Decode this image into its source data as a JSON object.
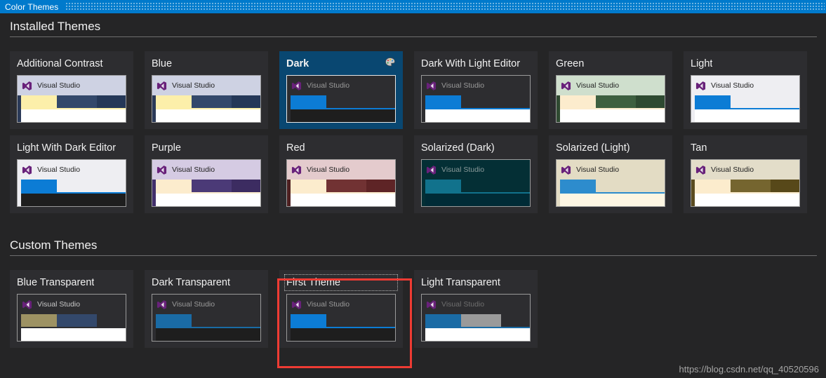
{
  "window": {
    "title": "Color Themes",
    "grip_icon": "dotted-grip-icon",
    "accent_color": "#007acc",
    "background_color": "#252526",
    "card_background_color": "#2d2d30",
    "selection_color": "#094771"
  },
  "sections": [
    {
      "id": "installed",
      "title": "Installed Themes"
    },
    {
      "id": "custom",
      "title": "Custom Themes"
    }
  ],
  "preview_logo_text": "Visual Studio",
  "installed_themes": [
    {
      "name": "Additional Contrast",
      "selected": false,
      "focused": false,
      "has_palette_icon": false,
      "colors": {
        "titlebar": "#ced2e3",
        "titlebar_text": "#1e1e1e",
        "gutter": "#2b3a58",
        "bar_a": "#fcefaa",
        "bar_b": "#33486b",
        "body": "#253858",
        "underline": "#fcefaa",
        "doc": "#ffffff"
      }
    },
    {
      "name": "Blue",
      "selected": false,
      "focused": false,
      "has_palette_icon": false,
      "colors": {
        "titlebar": "#ced2e3",
        "titlebar_text": "#1e1e1e",
        "gutter": "#2b3a58",
        "bar_a": "#fcefaa",
        "bar_b": "#33486b",
        "body": "#253858",
        "underline": "#fcefaa",
        "doc": "#ffffff"
      }
    },
    {
      "name": "Dark",
      "selected": true,
      "focused": false,
      "has_palette_icon": true,
      "palette_icon": "palette-icon",
      "colors": {
        "titlebar": "#2d2d30",
        "titlebar_text": "#9a9a9a",
        "gutter": "#2d2d30",
        "bar_a": "#0c7cd5",
        "bar_b": "#2d2d30",
        "body": "#2d2d30",
        "underline": "#0c7cd5",
        "doc": "#1e1e1e"
      }
    },
    {
      "name": "Dark With Light Editor",
      "selected": false,
      "focused": false,
      "has_palette_icon": false,
      "colors": {
        "titlebar": "#2d2d30",
        "titlebar_text": "#9a9a9a",
        "gutter": "#2d2d30",
        "bar_a": "#0c7cd5",
        "bar_b": "#2d2d30",
        "body": "#2d2d30",
        "underline": "#0c7cd5",
        "doc": "#ffffff"
      }
    },
    {
      "name": "Green",
      "selected": false,
      "focused": false,
      "has_palette_icon": false,
      "colors": {
        "titlebar": "#cfdfcd",
        "titlebar_text": "#1e1e1e",
        "gutter": "#2f4a31",
        "bar_a": "#fceccd",
        "bar_b": "#3e6040",
        "body": "#2e4a31",
        "underline": "#fceccd",
        "doc": "#ffffff"
      }
    },
    {
      "name": "Light",
      "selected": false,
      "focused": false,
      "has_palette_icon": false,
      "colors": {
        "titlebar": "#eeeef2",
        "titlebar_text": "#1e1e1e",
        "gutter": "#eeeef2",
        "bar_a": "#0c7cd5",
        "bar_b": "#eeeef2",
        "body": "#eeeef2",
        "underline": "#0c7cd5",
        "doc": "#ffffff"
      }
    },
    {
      "name": "Light With Dark Editor",
      "selected": false,
      "focused": false,
      "has_palette_icon": false,
      "colors": {
        "titlebar": "#eeeef2",
        "titlebar_text": "#1e1e1e",
        "gutter": "#eeeef2",
        "bar_a": "#0c7cd5",
        "bar_b": "#eeeef2",
        "body": "#eeeef2",
        "underline": "#0c7cd5",
        "doc": "#1e1e1e"
      }
    },
    {
      "name": "Purple",
      "selected": false,
      "focused": false,
      "has_palette_icon": false,
      "colors": {
        "titlebar": "#d5cbe3",
        "titlebar_text": "#1e1e1e",
        "gutter": "#422f6b",
        "bar_a": "#fceccd",
        "bar_b": "#4b3a77",
        "body": "#3c2c61",
        "underline": "#fceccd",
        "doc": "#ffffff"
      }
    },
    {
      "name": "Red",
      "selected": false,
      "focused": false,
      "has_palette_icon": false,
      "colors": {
        "titlebar": "#e4cbcd",
        "titlebar_text": "#1e1e1e",
        "gutter": "#4e2021",
        "bar_a": "#fceccd",
        "bar_b": "#713233",
        "body": "#5e2426",
        "underline": "#fceccd",
        "doc": "#ffffff"
      }
    },
    {
      "name": "Solarized (Dark)",
      "selected": false,
      "focused": false,
      "has_palette_icon": false,
      "colors": {
        "titlebar": "#042f35",
        "titlebar_text": "#8a9a9a",
        "gutter": "#042f35",
        "bar_a": "#11728c",
        "bar_b": "#042f35",
        "body": "#042f35",
        "underline": "#11728c",
        "doc": "#002b36"
      }
    },
    {
      "name": "Solarized (Light)",
      "selected": false,
      "focused": false,
      "has_palette_icon": false,
      "colors": {
        "titlebar": "#e3dcc4",
        "titlebar_text": "#1e1e1e",
        "gutter": "#e3dcc4",
        "bar_a": "#2d8ccd",
        "bar_b": "#e3dcc4",
        "body": "#e3dcc4",
        "underline": "#2d8ccd",
        "doc": "#fdf6e3"
      }
    },
    {
      "name": "Tan",
      "selected": false,
      "focused": false,
      "has_palette_icon": false,
      "colors": {
        "titlebar": "#e3ddc9",
        "titlebar_text": "#1e1e1e",
        "gutter": "#5b4c20",
        "bar_a": "#fceccd",
        "bar_b": "#75652f",
        "body": "#574819",
        "underline": "#fceccd",
        "doc": "#ffffff"
      }
    }
  ],
  "custom_themes": [
    {
      "name": "Blue Transparent",
      "selected": false,
      "focused": false,
      "has_palette_icon": false,
      "colors": {
        "titlebar": "#2d2d30",
        "titlebar_text": "#c8c8c8",
        "gutter": "#2d2d30",
        "bar_a": "#9d9263",
        "bar_b": "#33486b",
        "body": "#2d2d30",
        "underline": "#2d2d30",
        "doc": "#ffffff"
      }
    },
    {
      "name": "Dark Transparent",
      "selected": false,
      "focused": false,
      "has_palette_icon": false,
      "colors": {
        "titlebar": "#2d2d30",
        "titlebar_text": "#9a9a9a",
        "gutter": "#2d2d30",
        "bar_a": "#1a6ba5",
        "bar_b": "#2d2d30",
        "body": "#2d2d30",
        "underline": "#1a6ba5",
        "doc": "#1e1e1e"
      }
    },
    {
      "name": "First Theme",
      "selected": false,
      "focused": true,
      "has_palette_icon": false,
      "colors": {
        "titlebar": "#2d2d30",
        "titlebar_text": "#9a9a9a",
        "gutter": "#2d2d30",
        "bar_a": "#0c7cd5",
        "bar_b": "#2d2d30",
        "body": "#2d2d30",
        "underline": "#0c7cd5",
        "doc": "#1e1e1e"
      }
    },
    {
      "name": "Light Transparent",
      "selected": false,
      "focused": false,
      "has_palette_icon": false,
      "colors": {
        "titlebar": "#2d2d30",
        "titlebar_text": "#6e6e6e",
        "gutter": "#2d2d30",
        "bar_a": "#1a6ba5",
        "bar_b": "#9a9a9a",
        "body": "#2d2d30",
        "underline": "#1a6ba5",
        "doc": "#ffffff"
      }
    }
  ],
  "annotation": {
    "shape": "rectangle",
    "color": "#ee3b33",
    "target_theme": "First Theme"
  },
  "watermark": "https://blog.csdn.net/qq_40520596"
}
